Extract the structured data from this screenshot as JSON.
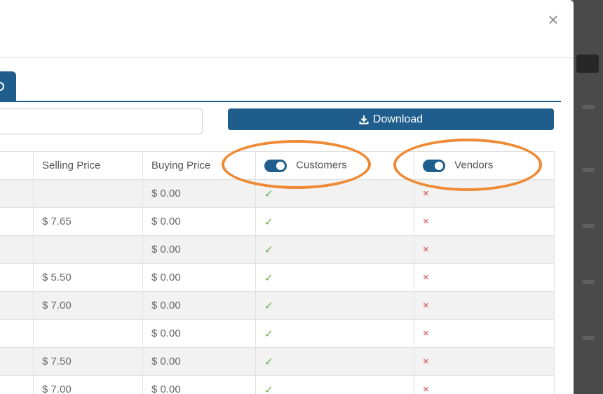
{
  "modal": {
    "close_icon": "×",
    "tab_icon": "settings-icon"
  },
  "search": {
    "value": "",
    "placeholder": ""
  },
  "download": {
    "label": "Download",
    "icon": "download-icon"
  },
  "table": {
    "headers": {
      "selling_price": "Selling Price",
      "buying_price": "Buying Price",
      "customers": "Customers",
      "vendors": "Vendors"
    },
    "customers_toggle_on": true,
    "vendors_toggle_on": true,
    "rows": [
      {
        "selling": "",
        "buying": "$ 0.00",
        "customers": "✓",
        "vendors": "×"
      },
      {
        "selling": "$ 7.65",
        "buying": "$ 0.00",
        "customers": "✓",
        "vendors": "×"
      },
      {
        "selling": "",
        "buying": "$ 0.00",
        "customers": "✓",
        "vendors": "×"
      },
      {
        "selling": "$ 5.50",
        "buying": "$ 0.00",
        "customers": "✓",
        "vendors": "×"
      },
      {
        "selling": "$ 7.00",
        "buying": "$ 0.00",
        "customers": "✓",
        "vendors": "×"
      },
      {
        "selling": "",
        "buying": "$ 0.00",
        "customers": "✓",
        "vendors": "×"
      },
      {
        "selling": "$ 7.50",
        "buying": "$ 0.00",
        "customers": "✓",
        "vendors": "×"
      },
      {
        "selling": "$ 7.00",
        "buying": "$ 0.00",
        "customers": "✓",
        "vendors": "×"
      }
    ]
  },
  "colors": {
    "primary": "#1f5d8c",
    "annotation": "#ee8a35",
    "check": "#5aae3c",
    "cross": "#d64545"
  }
}
